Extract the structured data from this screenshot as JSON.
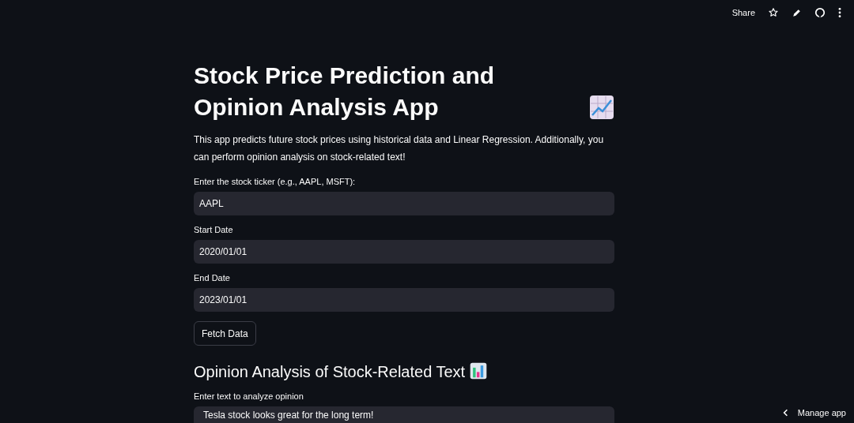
{
  "toolbar": {
    "share": "Share"
  },
  "title": "Stock Price Prediction and Opinion Analysis App",
  "intro": "This app predicts future stock prices using historical data and Linear Regression. Additionally, you can perform opinion analysis on stock-related text!",
  "fields": [
    {
      "label": "Enter the stock ticker (e.g., AAPL, MSFT):",
      "value": "AAPL"
    },
    {
      "label": "Start Date",
      "value": "2020/01/01"
    },
    {
      "label": "End Date",
      "value": "2023/01/01"
    }
  ],
  "fetch_button": "Fetch Data",
  "section_heading": "Opinion Analysis of Stock-Related Text",
  "opinion_field": {
    "label": "Enter text to analyze opinion",
    "value": "Tesla stock looks great for the long term!"
  },
  "manage_app": "Manage app"
}
